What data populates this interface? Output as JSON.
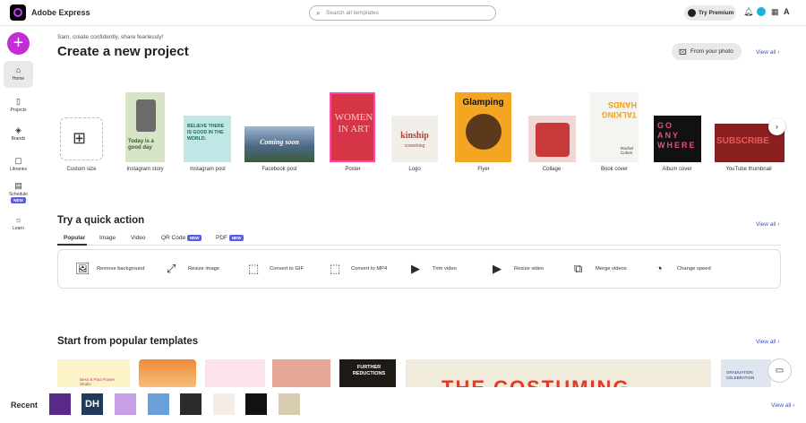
{
  "header": {
    "app_name": "Adobe Express",
    "search_placeholder": "Search all templates",
    "premium_label": "Try Premium"
  },
  "sidebar": {
    "items": [
      {
        "label": "Home"
      },
      {
        "label": "Projects"
      },
      {
        "label": "Brands"
      },
      {
        "label": "Libraries"
      },
      {
        "label": "Schedule"
      },
      {
        "label": "Learn"
      }
    ],
    "new_badge": "NEW"
  },
  "main": {
    "greeting": "Sam, create confidently, share fearlessly!",
    "title": "Create a new project",
    "from_photo": "From your photo",
    "view_all": "View all",
    "project_types": [
      "Custom size",
      "Instagram story",
      "Instagram post",
      "Facebook post",
      "Poster",
      "Logo",
      "Flyer",
      "Collage",
      "Book cover",
      "Album cover",
      "YouTube thumbnail"
    ],
    "card_texts": {
      "story": "Today is a good day",
      "ipost": "BELIEVE THERE IS GOOD IN THE WORLD.",
      "fb": "Coming soon",
      "poster": "WOMEN IN ART",
      "logo": "kinship",
      "logo_sub": "coworking",
      "flyer": "Glamping",
      "book": "TALKING HANDS",
      "book_author": "Rachel Cohen",
      "album": "GO ANY WHERE",
      "yt": "SUBSCRIBE"
    }
  },
  "quick": {
    "title": "Try a quick action",
    "tabs": [
      "Popular",
      "Image",
      "Video",
      "QR Code",
      "PDF"
    ],
    "new_badge": "NEW",
    "actions": [
      "Remove background",
      "Resize image",
      "Convert to GIF",
      "Convert to MP4",
      "Trim video",
      "Resize video",
      "Merge videos",
      "Change speed"
    ]
  },
  "templates": {
    "title": "Start from popular templates",
    "card_texts": {
      "t2": "Bess & Paul Flower Studio",
      "t5": "FURTHER REDUCTIONS",
      "t6": "THE COSTUMING",
      "t7": "GRADUATION CELEBRATION"
    }
  },
  "recent": {
    "label": "Recent",
    "dh": "DH"
  },
  "colors": {
    "accent": "#3b4fd8",
    "plus": "#c22ed3",
    "new_badge": "#5c5ce0"
  }
}
